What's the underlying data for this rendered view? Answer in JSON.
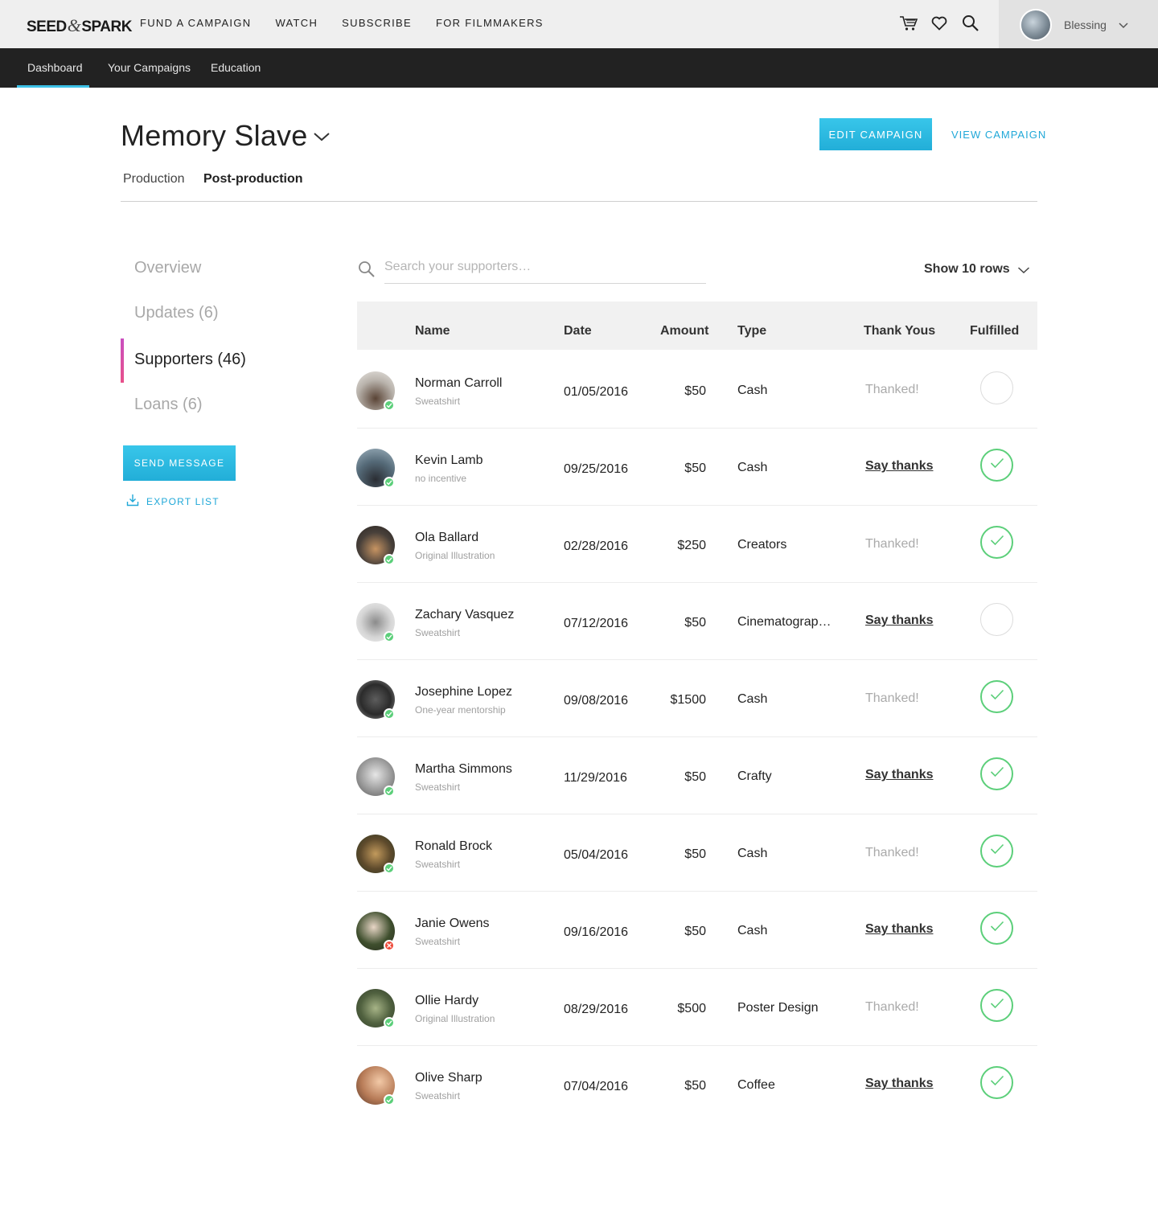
{
  "brand": {
    "logo_left": "SEED",
    "logo_amp": "&",
    "logo_right": "SPARK"
  },
  "topnav": [
    "FUND A CAMPAIGN",
    "WATCH",
    "SUBSCRIBE",
    "FOR FILMMAKERS"
  ],
  "user": {
    "name": "Blessing"
  },
  "subnav": [
    "Dashboard",
    "Your Campaigns",
    "Education"
  ],
  "campaign": {
    "title": "Memory Slave",
    "edit_label": "EDIT CAMPAIGN",
    "view_label": "VIEW CAMPAIGN",
    "phases": [
      "Production",
      "Post-production"
    ]
  },
  "sidenav": {
    "items": [
      "Overview",
      "Updates (6)",
      "Supporters (46)",
      "Loans (6)"
    ],
    "active": "Supporters (46)",
    "send_label": "SEND MESSAGE",
    "export_label": "EXPORT LIST"
  },
  "search": {
    "placeholder": "Search your supporters…"
  },
  "rows_select": "Show 10 rows",
  "table": {
    "headers": [
      "Name",
      "Date",
      "Amount",
      "Type",
      "Thank Yous",
      "Fulfilled"
    ],
    "rows": [
      {
        "name": "Norman Carroll",
        "reward": "Sweatshirt",
        "date": "01/05/2016",
        "amount": "$50",
        "type": "Cash",
        "thanks": "Thanked!",
        "thanked": true,
        "fulfilled": false,
        "status": "ok"
      },
      {
        "name": "Kevin Lamb",
        "reward": "no incentive",
        "date": "09/25/2016",
        "amount": "$50",
        "type": "Cash",
        "thanks": "Say thanks",
        "thanked": false,
        "fulfilled": true,
        "status": "ok"
      },
      {
        "name": "Ola Ballard",
        "reward": "Original Illustration",
        "date": "02/28/2016",
        "amount": "$250",
        "type": "Creators",
        "thanks": "Thanked!",
        "thanked": true,
        "fulfilled": true,
        "status": "ok"
      },
      {
        "name": "Zachary Vasquez",
        "reward": "Sweatshirt",
        "date": "07/12/2016",
        "amount": "$50",
        "type": "Cinematograp…",
        "thanks": "Say thanks",
        "thanked": false,
        "fulfilled": false,
        "status": "ok"
      },
      {
        "name": "Josephine Lopez",
        "reward": "One-year mentorship",
        "date": "09/08/2016",
        "amount": "$1500",
        "type": "Cash",
        "thanks": "Thanked!",
        "thanked": true,
        "fulfilled": true,
        "status": "ok"
      },
      {
        "name": "Martha Simmons",
        "reward": "Sweatshirt",
        "date": "11/29/2016",
        "amount": "$50",
        "type": "Crafty",
        "thanks": "Say thanks",
        "thanked": false,
        "fulfilled": true,
        "status": "ok"
      },
      {
        "name": "Ronald Brock",
        "reward": "Sweatshirt",
        "date": "05/04/2016",
        "amount": "$50",
        "type": "Cash",
        "thanks": "Thanked!",
        "thanked": true,
        "fulfilled": true,
        "status": "ok"
      },
      {
        "name": "Janie Owens",
        "reward": "Sweatshirt",
        "date": "09/16/2016",
        "amount": "$50",
        "type": "Cash",
        "thanks": "Say thanks",
        "thanked": false,
        "fulfilled": true,
        "status": "error"
      },
      {
        "name": "Ollie Hardy",
        "reward": "Original Illustration",
        "date": "08/29/2016",
        "amount": "$500",
        "type": "Poster Design",
        "thanks": "Thanked!",
        "thanked": true,
        "fulfilled": true,
        "status": "ok"
      },
      {
        "name": "Olive Sharp",
        "reward": "Sweatshirt",
        "date": "07/04/2016",
        "amount": "$50",
        "type": "Coffee",
        "thanks": "Say thanks",
        "thanked": false,
        "fulfilled": true,
        "status": "ok"
      }
    ]
  },
  "colors": {
    "accent": "#22aed8",
    "success": "#5ccf7a",
    "error": "#ee4a3a",
    "active_bar": "#e8508a"
  },
  "icons": [
    "cart-icon",
    "heart-icon",
    "search-icon",
    "chevron-down-icon",
    "download-icon",
    "checkmark-icon"
  ]
}
